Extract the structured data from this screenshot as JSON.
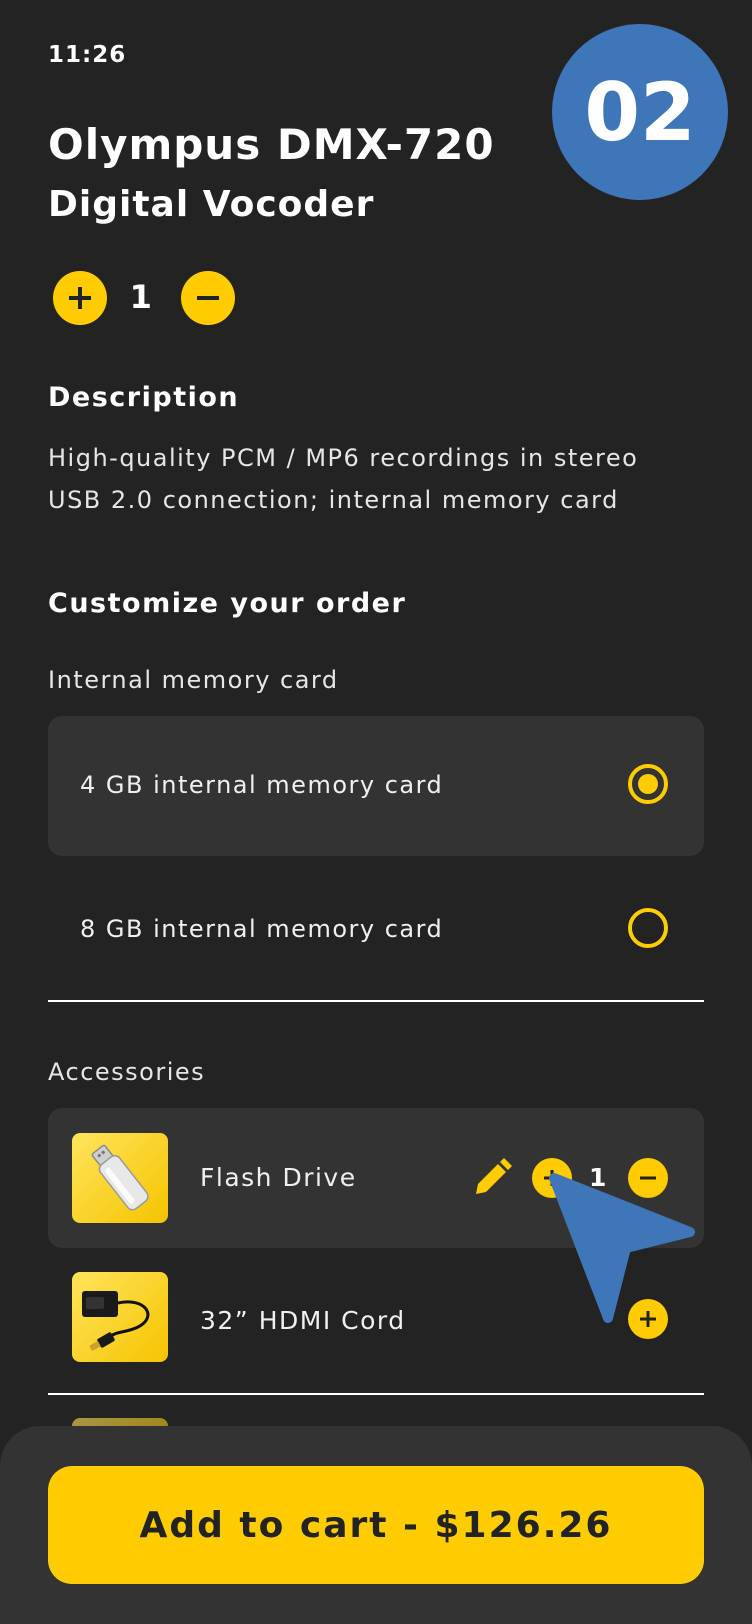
{
  "status_bar": {
    "time": "11:26"
  },
  "step_badge": "02",
  "product": {
    "title": "Olympus DMX-720",
    "subtitle": "Digital Vocoder",
    "quantity": "1"
  },
  "description": {
    "heading": "Description",
    "lines": [
      "High-quality PCM / MP6 recordings in stereo",
      "USB 2.0 connection; internal memory card"
    ]
  },
  "customize": {
    "heading": "Customize your order",
    "memory": {
      "label": "Internal memory card",
      "options": [
        {
          "label": "4 GB internal memory card",
          "selected": true
        },
        {
          "label": "8 GB internal memory card",
          "selected": false
        }
      ]
    },
    "accessories": {
      "label": "Accessories",
      "items": [
        {
          "name": "Flash Drive",
          "quantity": "1",
          "icon": "flash-drive-image"
        },
        {
          "name": "32” HDMI Cord",
          "icon": "hdmi-cord-image"
        }
      ]
    }
  },
  "cart": {
    "button_label": "Add to cart - $126.26"
  },
  "colors": {
    "accent": "#ffcc00",
    "background": "#232323",
    "card": "#333333",
    "badge": "#3f76b8"
  }
}
